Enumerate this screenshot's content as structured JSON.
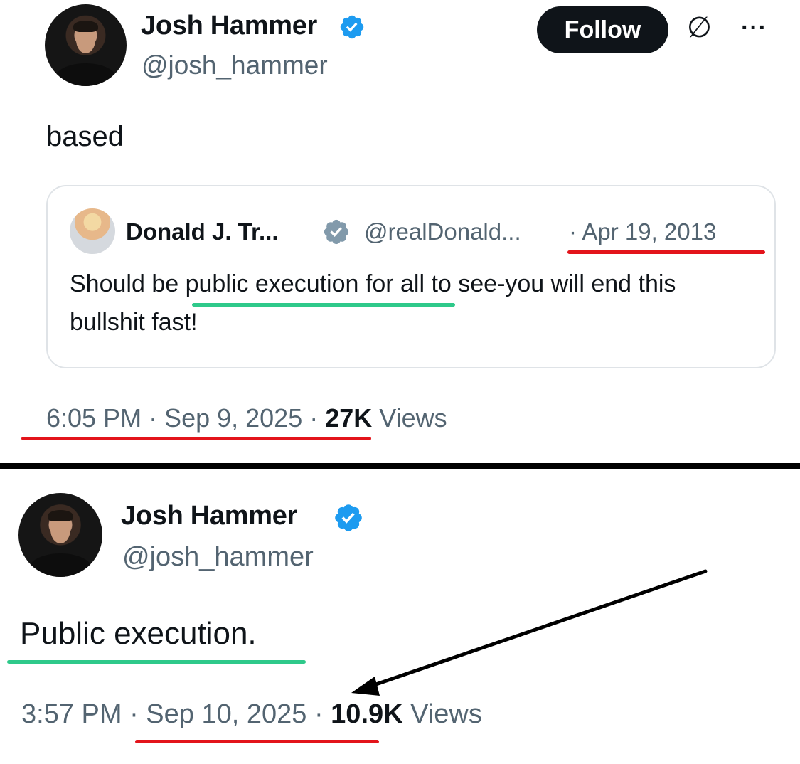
{
  "top_tweet": {
    "author_name": "Josh Hammer",
    "author_handle": "@josh_hammer",
    "follow_label": "Follow",
    "grok_icon": "∅",
    "more_icon": "···",
    "text": "based",
    "quote": {
      "author_name": "Donald J. Tr...",
      "author_handle": "@realDonald...",
      "date": "· Apr 19, 2013",
      "text_before": "Should be ",
      "text_highlight": "public execution",
      "text_after": " for all to see-you will end this bullshit fast!"
    },
    "time_date": "6:05 PM · Sep 9, 2025 · ",
    "views_count": "27K",
    "views_label": " Views"
  },
  "bottom_tweet": {
    "author_name": "Josh Hammer",
    "author_handle": "@josh_hammer",
    "text": "Public execution.",
    "time": "3:57 PM · ",
    "date": "Sep 10, 2025",
    "sep": " · ",
    "views_count": "10.9K",
    "views_label": " Views"
  },
  "colors": {
    "verified_blue": "#1d9bf0",
    "grey_badge": "#829aab",
    "annotation_red": "#e3141b",
    "annotation_green": "#2ec98a"
  }
}
